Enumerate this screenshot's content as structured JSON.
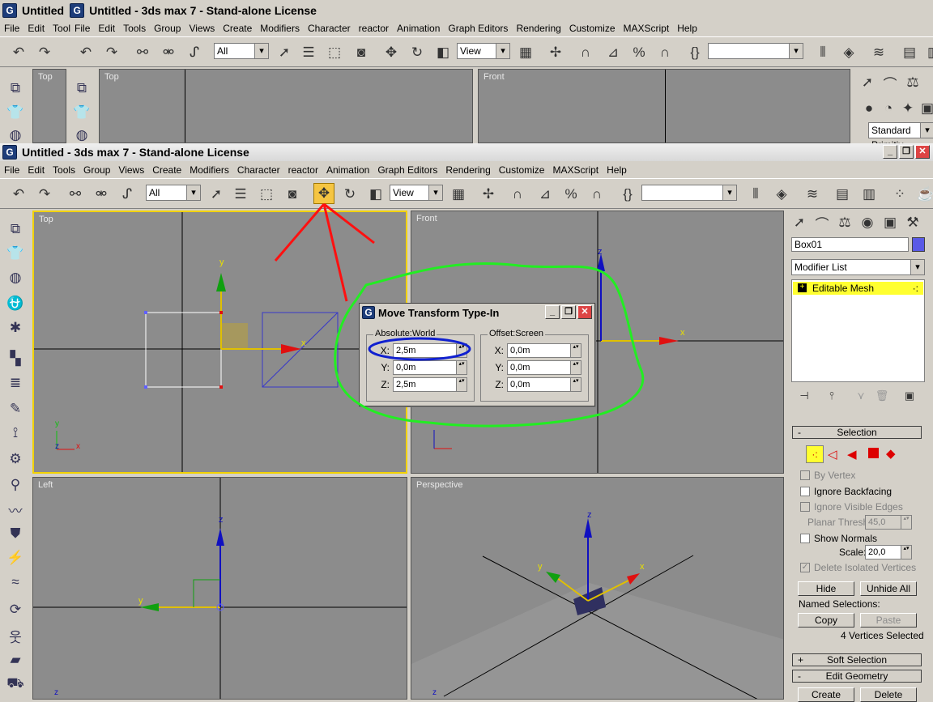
{
  "back_window": {
    "title": "Untitled  - 3ds max 7  - Stand-alone License",
    "menu_prefix": [
      "File",
      "Edit",
      "Tool"
    ],
    "menu": [
      "File",
      "Edit",
      "Tools",
      "Group",
      "Views",
      "Create",
      "Modifiers",
      "Character",
      "reactor",
      "Animation",
      "Graph Editors",
      "Rendering",
      "Customize",
      "MAXScript",
      "Help"
    ],
    "selection_filter": "All",
    "ref_coord": "View",
    "viewports": [
      "Top",
      "Top",
      "Front"
    ],
    "cmd_dropdown": "Standard Primitiv"
  },
  "window": {
    "title": "Untitled  - 3ds max 7  - Stand-alone License",
    "menu": [
      "File",
      "Edit",
      "Tools",
      "Group",
      "Views",
      "Create",
      "Modifiers",
      "Character",
      "reactor",
      "Animation",
      "Graph Editors",
      "Rendering",
      "Customize",
      "MAXScript",
      "Help"
    ],
    "selection_filter": "All",
    "ref_coord": "View"
  },
  "viewports": {
    "top": {
      "label": "Top"
    },
    "front": {
      "label": "Front"
    },
    "left": {
      "label": "Left"
    },
    "perspective": {
      "label": "Perspective"
    }
  },
  "axis_labels": {
    "x": "x",
    "y": "y",
    "z": "z"
  },
  "dialog": {
    "title": "Move Transform Type-In",
    "absolute_group": "Absolute:World",
    "offset_group": "Offset:Screen",
    "absolute": {
      "x": "2,5m",
      "y": "0,0m",
      "z": "2,5m"
    },
    "offset": {
      "x": "0,0m",
      "y": "0,0m",
      "z": "0,0m"
    },
    "labels": {
      "x": "X:",
      "y": "Y:",
      "z": "Z:"
    }
  },
  "command_panel": {
    "object_name": "Box01",
    "object_color": "#5a5ae6",
    "modifier_list": "Modifier List",
    "stack_item": "Editable Mesh",
    "selection_rollout": "Selection",
    "by_vertex": "By Vertex",
    "ignore_backfacing": "Ignore Backfacing",
    "ignore_visible_edges": "Ignore Visible Edges",
    "planar_thresh_label": "Planar Thresh:",
    "planar_thresh_value": "45,0",
    "show_normals": "Show Normals",
    "scale_label": "Scale:",
    "scale_value": "20,0",
    "delete_isolated": "Delete Isolated Vertices",
    "hide": "Hide",
    "unhide_all": "Unhide All",
    "named_selections": "Named Selections:",
    "copy": "Copy",
    "paste": "Paste",
    "status": "4 Vertices Selected",
    "soft_selection": "Soft Selection",
    "edit_geometry": "Edit Geometry",
    "create": "Create",
    "delete": "Delete"
  },
  "colors": {
    "annotation_red": "#ff1010",
    "annotation_green": "#22ee22",
    "annotation_blue": "#1020d0",
    "active_viewport": "#f2d200"
  }
}
